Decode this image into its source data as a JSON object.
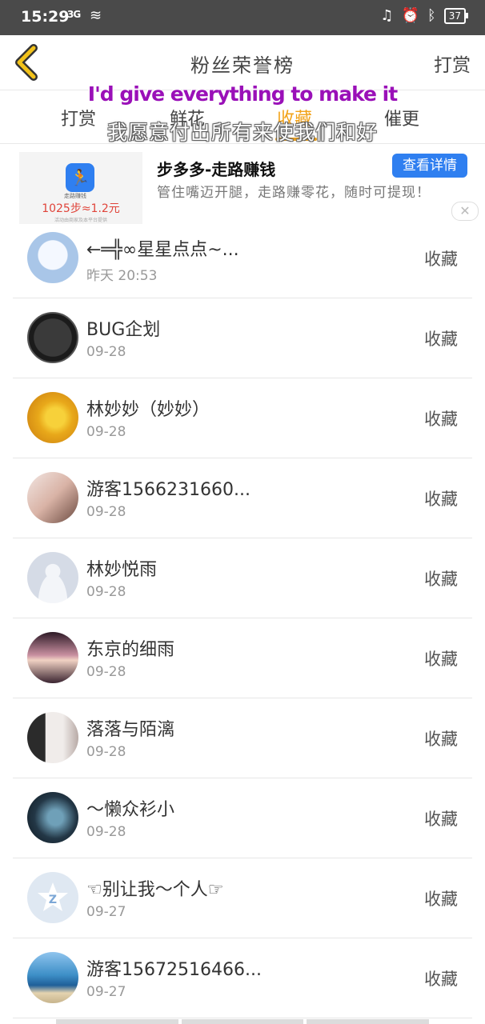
{
  "status_bar": {
    "time": "15:29",
    "network": "3G",
    "battery": "37"
  },
  "header": {
    "title": "粉丝荣誉榜",
    "reward_label": "打赏"
  },
  "tabs": [
    {
      "label": "打赏",
      "active": false
    },
    {
      "label": "鲜花",
      "active": false
    },
    {
      "label": "收藏",
      "active": true
    },
    {
      "label": "催更",
      "active": false
    }
  ],
  "subtitle": {
    "english": "I'd give everything to make it",
    "chinese": "我愿意付出所有来使我们和好"
  },
  "ad": {
    "title": "步多多-走路赚钱",
    "button_label": "查看详情",
    "description": "管住嘴迈开腿，走路赚零花，随时可提现！",
    "image_caption": "走路赚钱",
    "image_price": "1025步≈1.2元",
    "image_fine_print": "活动由商家及本平台提供"
  },
  "users": [
    {
      "name": "←═╬∞星星点点~...",
      "date": "昨天 20:53",
      "action": "收藏",
      "avatar_color": "#a9c6e8"
    },
    {
      "name": "BUG企划",
      "date": "09-28",
      "action": "收藏",
      "avatar_color": "#2a2a2a"
    },
    {
      "name": "林妙妙（妙妙）",
      "date": "09-28",
      "action": "收藏",
      "avatar_color": "#e8a81a"
    },
    {
      "name": "游客156623166​0...",
      "date": "09-28",
      "action": "收藏",
      "avatar_color": "#d9b3a6"
    },
    {
      "name": "林妙悦雨",
      "date": "09-28",
      "action": "收藏",
      "avatar_color": "#d5dbe6"
    },
    {
      "name": "东京的细雨",
      "date": "09-28",
      "action": "收藏",
      "avatar_color": "#9b6d7d"
    },
    {
      "name": "落落与陌漓",
      "date": "09-28",
      "action": "收藏",
      "avatar_color": "#cfc2c0"
    },
    {
      "name": "〜懒众衫小",
      "date": "09-28",
      "action": "收藏",
      "avatar_color": "#233746"
    },
    {
      "name": "☜别让我〜个人☞",
      "date": "09-27",
      "action": "收藏",
      "avatar_color": "#dfe8f2"
    },
    {
      "name": "游客15672516466...",
      "date": "09-27",
      "action": "收藏",
      "avatar_color": "#3d8fc7"
    }
  ]
}
